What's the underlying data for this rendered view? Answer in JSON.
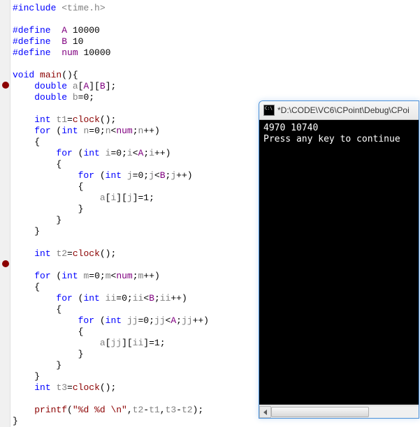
{
  "code": {
    "l1_pp": "#include",
    "l1_hdr": "<time.h>",
    "l3_pp": "#define",
    "l3_name": "A",
    "l3_val": "10000",
    "l4_pp": "#define",
    "l4_name": "B",
    "l4_val": "10",
    "l5_pp": "#define",
    "l5_name": "num",
    "l5_val": "10000",
    "l7_kw": "void",
    "l7_fn": "main",
    "l7_paren": "(){",
    "l8_kw": "double",
    "l8_var": "a",
    "l8_A": "A",
    "l8_B": "B",
    "l9_kw": "double",
    "l9_var": "b",
    "l9_val": "0",
    "l11_kw": "int",
    "l11_var": "t1",
    "l11_fn": "clock",
    "l12_kw1": "for",
    "l12_kw2": "int",
    "l12_var": "n",
    "l12_val": "0",
    "l12_num": "num",
    "l14_kw1": "for",
    "l14_kw2": "int",
    "l14_var": "i",
    "l14_val": "0",
    "l14_A": "A",
    "l16_kw1": "for",
    "l16_kw2": "int",
    "l16_var": "j",
    "l16_val": "0",
    "l16_B": "B",
    "l18_a": "a",
    "l18_i": "i",
    "l18_j": "j",
    "l18_val": "1",
    "l23_kw": "int",
    "l23_var": "t2",
    "l23_fn": "clock",
    "l25_kw1": "for",
    "l25_kw2": "int",
    "l25_var": "m",
    "l25_val": "0",
    "l25_num": "num",
    "l27_kw1": "for",
    "l27_kw2": "int",
    "l27_var": "ii",
    "l27_val": "0",
    "l27_B": "B",
    "l29_kw1": "for",
    "l29_kw2": "int",
    "l29_var": "jj",
    "l29_val": "0",
    "l29_A": "A",
    "l31_a": "a",
    "l31_jj": "jj",
    "l31_ii": "ii",
    "l31_val": "1",
    "l35_kw": "int",
    "l35_var": "t3",
    "l35_fn": "clock",
    "l37_fn": "printf",
    "l37_str": "\"%d %d \\n\"",
    "l37_t2": "t2",
    "l37_t1": "t1",
    "l37_t3": "t3",
    "l37_t2b": "t2"
  },
  "console": {
    "title": "*D:\\CODE\\VC6\\CPoint\\Debug\\CPoi",
    "line1": "4970 10740",
    "line2": "Press any key to continue"
  }
}
